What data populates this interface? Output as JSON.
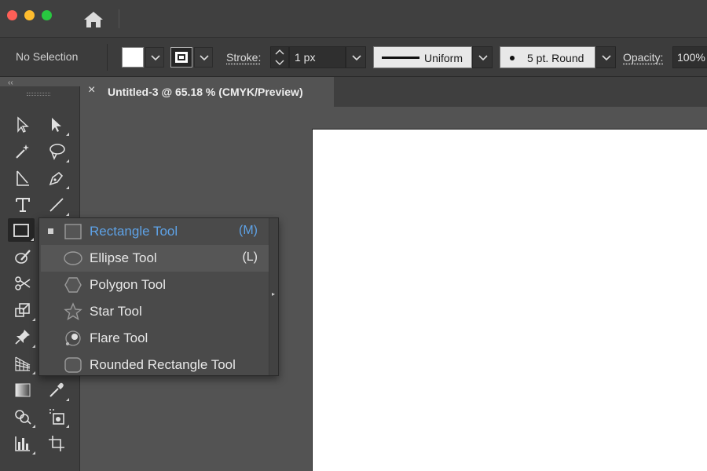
{
  "window": {
    "traffic": {
      "close": "×",
      "minimize": "−",
      "maximize": "+"
    },
    "home_icon": "home-icon"
  },
  "control_bar": {
    "selection_status": "No Selection",
    "stroke_label": "Stroke:",
    "stroke_weight": "1 px",
    "variable_width_profile": "Uniform",
    "brush_definition": "5 pt. Round",
    "opacity_label": "Opacity:",
    "opacity_value": "100%",
    "fill_color": "#ffffff"
  },
  "document_tab": {
    "close_glyph": "×",
    "title": "Untitled-3 @ 65.18 % (CMYK/Preview)"
  },
  "toolbar": {
    "collapse_glyph": "‹‹",
    "tools": [
      "selection-tool",
      "direct-selection-tool",
      "magic-wand-tool",
      "lasso-tool",
      "curvature-tool",
      "pen-tool",
      "type-tool",
      "line-segment-tool",
      "rectangle-tool",
      "paintbrush-tool",
      "scissors-tool",
      "scale-tool",
      "puppet-warp-tool",
      "perspective-grid-tool",
      "gradient-tool",
      "eyedropper-tool",
      "shape-builder-tool",
      "live-paint-bucket-tool",
      "column-graph-tool",
      "artboard-tool"
    ]
  },
  "flyout": {
    "items": [
      {
        "label": "Rectangle Tool",
        "shortcut": "(M)",
        "icon": "rectangle-icon",
        "selected": true
      },
      {
        "label": "Ellipse Tool",
        "shortcut": "(L)",
        "icon": "ellipse-icon",
        "hover": true
      },
      {
        "label": "Polygon Tool",
        "shortcut": "",
        "icon": "polygon-icon"
      },
      {
        "label": "Star Tool",
        "shortcut": "",
        "icon": "star-icon"
      },
      {
        "label": "Flare Tool",
        "shortcut": "",
        "icon": "flare-icon"
      },
      {
        "label": "Rounded Rectangle Tool",
        "shortcut": "",
        "icon": "rounded-rectangle-icon"
      }
    ],
    "accent_color": "#5ea2e6"
  }
}
